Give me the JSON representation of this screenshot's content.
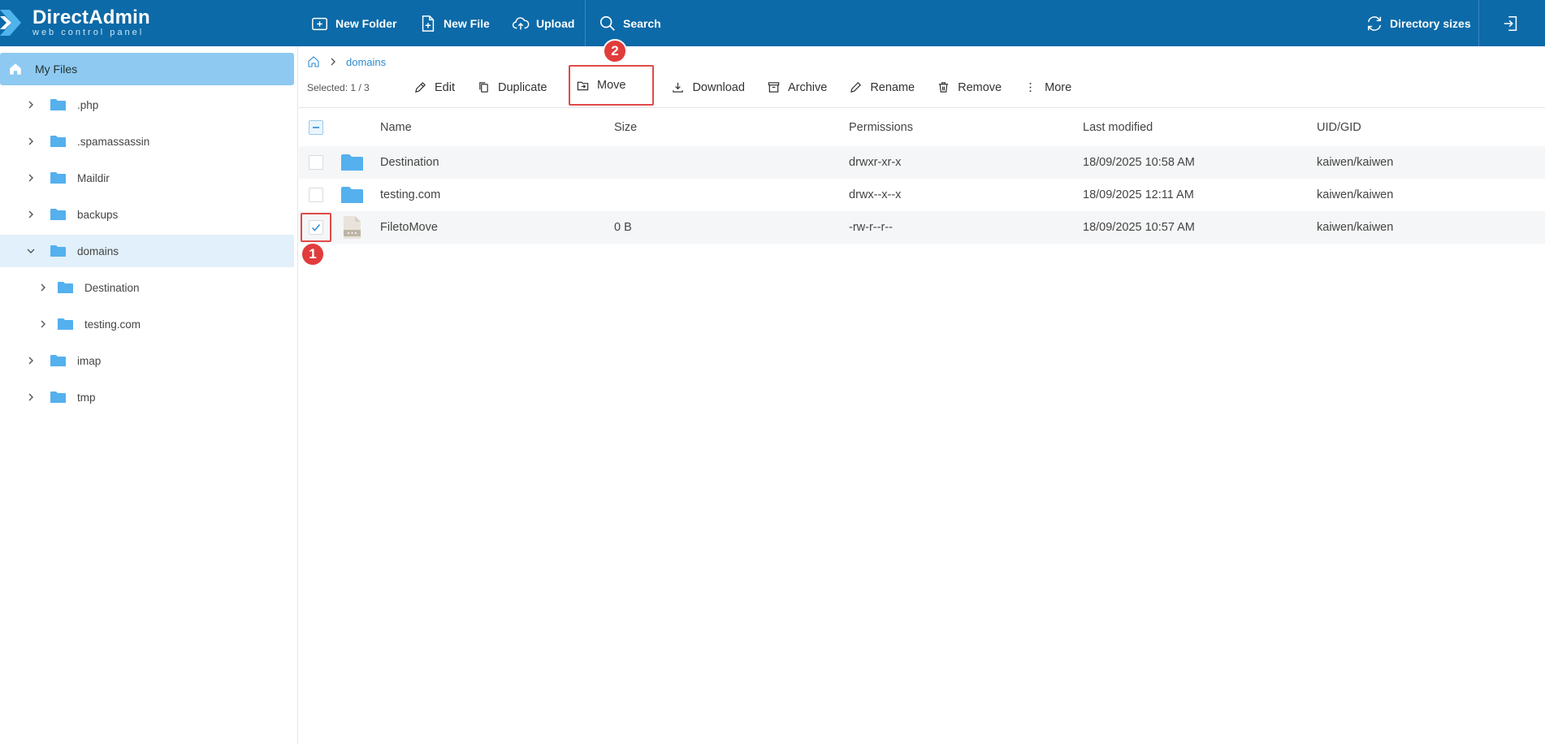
{
  "brand": {
    "name": "DirectAdmin",
    "tagline": "web control panel"
  },
  "toolbar": {
    "new_folder": "New Folder",
    "new_file": "New File",
    "upload": "Upload",
    "search": "Search",
    "directory_sizes": "Directory sizes"
  },
  "sidebar": {
    "root": "My Files",
    "items": [
      {
        "label": ".php"
      },
      {
        "label": ".spamassassin"
      },
      {
        "label": "Maildir"
      },
      {
        "label": "backups"
      },
      {
        "label": "domains"
      },
      {
        "label": "Destination"
      },
      {
        "label": "testing.com"
      },
      {
        "label": "imap"
      },
      {
        "label": "tmp"
      }
    ]
  },
  "breadcrumb": {
    "current": "domains"
  },
  "actions": {
    "selected": "Selected: 1 / 3",
    "edit": "Edit",
    "duplicate": "Duplicate",
    "move": "Move",
    "download": "Download",
    "archive": "Archive",
    "rename": "Rename",
    "remove": "Remove",
    "more": "More"
  },
  "table": {
    "headers": [
      "Name",
      "Size",
      "Permissions",
      "Last modified",
      "UID/GID"
    ],
    "rows": [
      {
        "name": "Destination",
        "size": "",
        "permissions": "drwxr-xr-x",
        "modified": "18/09/2025 10:58 AM",
        "owner": "kaiwen/kaiwen",
        "type": "folder",
        "checked": false
      },
      {
        "name": "testing.com",
        "size": "",
        "permissions": "drwx--x--x",
        "modified": "18/09/2025 12:11 AM",
        "owner": "kaiwen/kaiwen",
        "type": "folder",
        "checked": false
      },
      {
        "name": "FiletoMove",
        "size": "0 B",
        "permissions": "-rw-r--r--",
        "modified": "18/09/2025 10:57 AM",
        "owner": "kaiwen/kaiwen",
        "type": "file",
        "checked": true
      }
    ]
  },
  "annotations": {
    "step1": "1",
    "step2": "2"
  },
  "colors": {
    "topbar": "#0c6aa8",
    "accent": "#2d8ad0",
    "highlight": "#e04a4a",
    "folder": "#55b0ee"
  }
}
